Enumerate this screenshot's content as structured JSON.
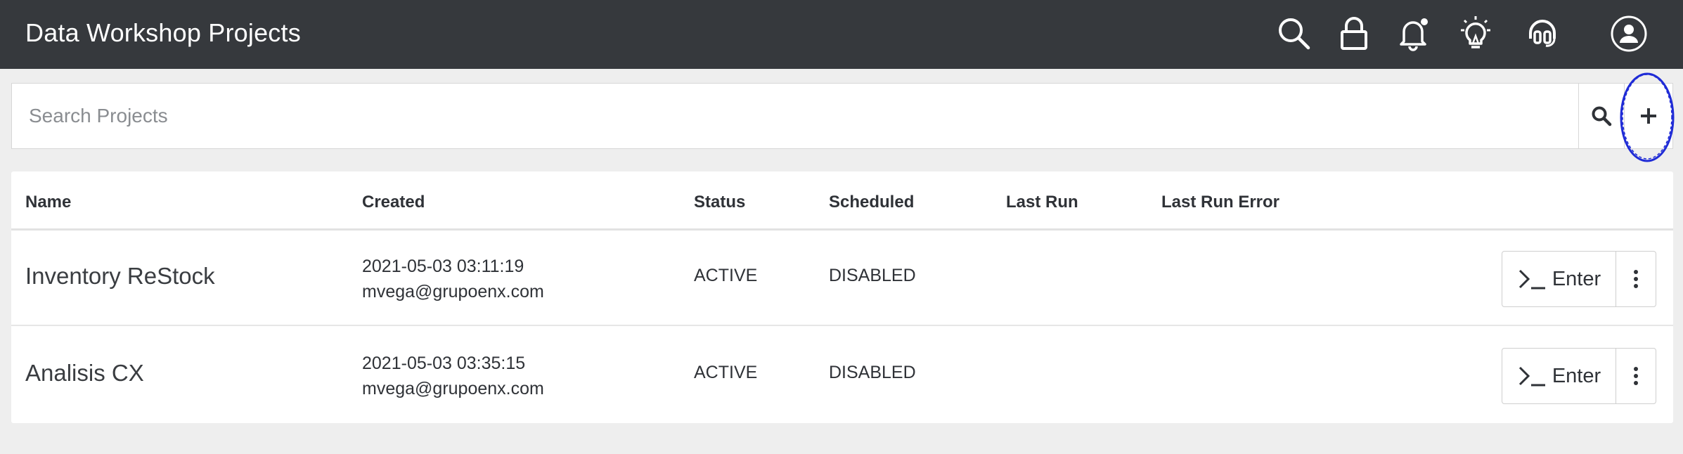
{
  "header": {
    "title": "Data Workshop Projects",
    "icons": [
      "search-icon",
      "lock-icon",
      "bell-icon",
      "lightbulb-icon",
      "headset-icon",
      "user-icon"
    ],
    "background": "#36393d"
  },
  "search": {
    "placeholder": "Search Projects",
    "value": "",
    "search_icon": "search-icon",
    "add_icon": "plus-icon",
    "highlight_color": "#1f2bd6"
  },
  "table": {
    "columns": [
      "Name",
      "Created",
      "Status",
      "Scheduled",
      "Last Run",
      "Last Run Error"
    ],
    "rows": [
      {
        "name": "Inventory ReStock",
        "created_date": "2021-05-03 03:11:19",
        "created_by": "mvega@grupoenx.com",
        "status": "ACTIVE",
        "scheduled": "DISABLED",
        "last_run": "",
        "last_run_error": "",
        "action_label": "Enter"
      },
      {
        "name": "Analisis CX",
        "created_date": "2021-05-03 03:35:15",
        "created_by": "mvega@grupoenx.com",
        "status": "ACTIVE",
        "scheduled": "DISABLED",
        "last_run": "",
        "last_run_error": "",
        "action_label": "Enter"
      }
    ]
  }
}
